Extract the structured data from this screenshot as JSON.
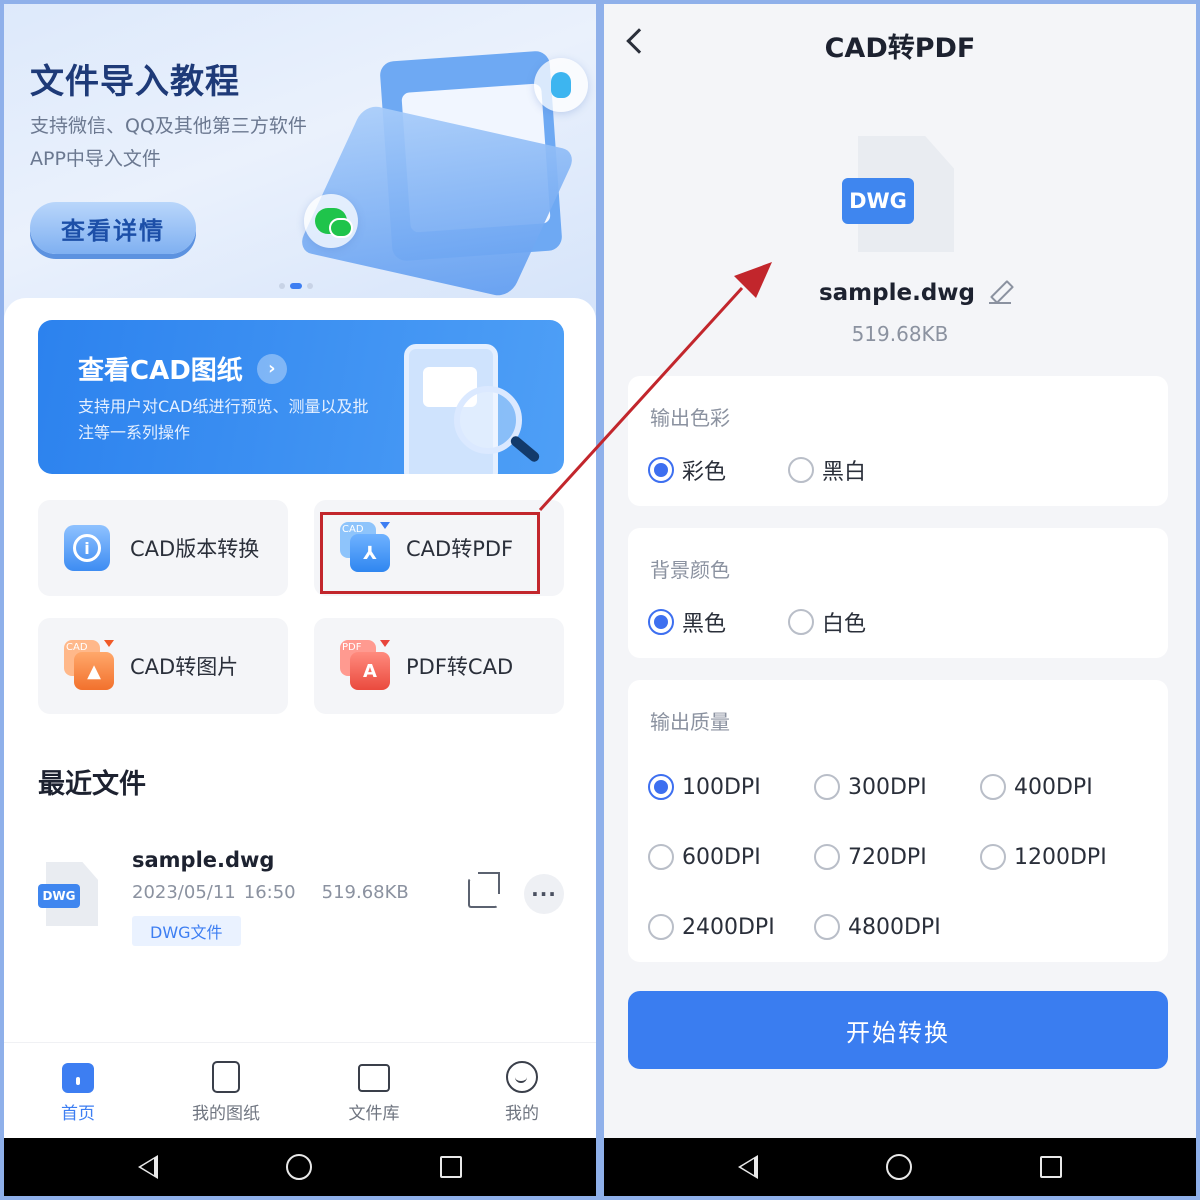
{
  "left": {
    "banner": {
      "title": "文件导入教程",
      "desc": "支持微信、QQ及其他第三方软件APP中导入文件",
      "button": "查看详情"
    },
    "cad_card": {
      "title": "查看CAD图纸",
      "desc": "支持用户对CAD纸进行预览、测量以及批注等一系列操作"
    },
    "tools": [
      {
        "label": "CAD版本转换",
        "icon": "cad-version-icon"
      },
      {
        "label": "CAD转PDF",
        "icon": "cad-to-pdf-icon",
        "tag": "CAD"
      },
      {
        "label": "CAD转图片",
        "icon": "cad-to-image-icon",
        "tag": "CAD"
      },
      {
        "label": "PDF转CAD",
        "icon": "pdf-to-cad-icon",
        "tag": "PDF"
      }
    ],
    "recent": {
      "title": "最近文件",
      "file": {
        "badge": "DWG",
        "name": "sample.dwg",
        "date": "2023/05/11",
        "time": "16:50",
        "size": "519.68KB",
        "tag": "DWG文件"
      }
    },
    "tabs": [
      {
        "label": "首页",
        "active": true
      },
      {
        "label": "我的图纸"
      },
      {
        "label": "文件库"
      },
      {
        "label": "我的"
      }
    ]
  },
  "right": {
    "header": {
      "title": "CAD转PDF"
    },
    "file": {
      "badge": "DWG",
      "name": "sample.dwg",
      "size": "519.68KB"
    },
    "output_color": {
      "title": "输出色彩",
      "options": [
        "彩色",
        "黑白"
      ],
      "selected": "彩色"
    },
    "background": {
      "title": "背景颜色",
      "options": [
        "黑色",
        "白色"
      ],
      "selected": "黑色"
    },
    "quality": {
      "title": "输出质量",
      "options": [
        "100DPI",
        "300DPI",
        "400DPI",
        "600DPI",
        "720DPI",
        "1200DPI",
        "2400DPI",
        "4800DPI"
      ],
      "selected": "100DPI"
    },
    "start_button": "开始转换"
  },
  "colors": {
    "accent": "#3d7ef2",
    "highlight": "#c2262c",
    "panel_bg": "#f4f5f8",
    "frame": "#8fb0ea"
  }
}
